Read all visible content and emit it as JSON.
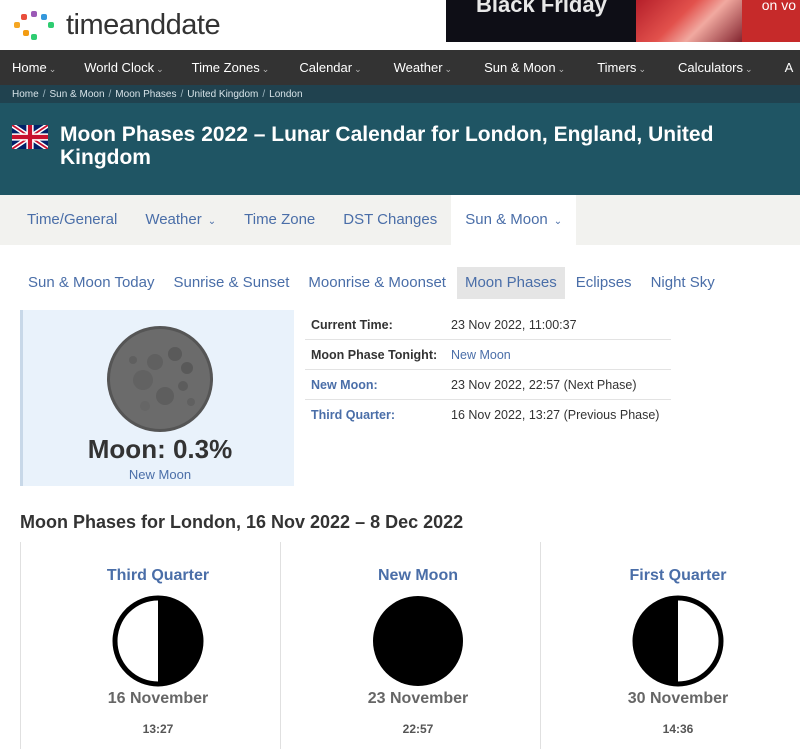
{
  "brand": {
    "name": "timeanddate"
  },
  "ad": {
    "headline": "Black Friday",
    "tagline": "on vo"
  },
  "nav": {
    "items": [
      {
        "label": "Home",
        "has_menu": true
      },
      {
        "label": "World Clock",
        "has_menu": true
      },
      {
        "label": "Time Zones",
        "has_menu": true
      },
      {
        "label": "Calendar",
        "has_menu": true
      },
      {
        "label": "Weather",
        "has_menu": true
      },
      {
        "label": "Sun & Moon",
        "has_menu": true
      },
      {
        "label": "Timers",
        "has_menu": true
      },
      {
        "label": "Calculators",
        "has_menu": true
      },
      {
        "label": "A",
        "has_menu": false
      }
    ]
  },
  "breadcrumb": [
    "Home",
    "Sun & Moon",
    "Moon Phases",
    "United Kingdom",
    "London"
  ],
  "page": {
    "title": "Moon Phases 2022 – Lunar Calendar for London, England, United Kingdom"
  },
  "subnav": {
    "items": [
      {
        "label": "Time/General",
        "active": false,
        "has_menu": false
      },
      {
        "label": "Weather",
        "active": false,
        "has_menu": true
      },
      {
        "label": "Time Zone",
        "active": false,
        "has_menu": false
      },
      {
        "label": "DST Changes",
        "active": false,
        "has_menu": false
      },
      {
        "label": "Sun & Moon",
        "active": true,
        "has_menu": true
      }
    ]
  },
  "tabs": {
    "items": [
      {
        "label": "Sun & Moon Today",
        "active": false
      },
      {
        "label": "Sunrise & Sunset",
        "active": false
      },
      {
        "label": "Moonrise & Moonset",
        "active": false
      },
      {
        "label": "Moon Phases",
        "active": true
      },
      {
        "label": "Eclipses",
        "active": false
      },
      {
        "label": "Night Sky",
        "active": false
      }
    ]
  },
  "moon_now": {
    "illumination": "Moon: 0.3%",
    "phase": "New Moon"
  },
  "info": {
    "rows": [
      {
        "label": "Current Time:",
        "value": "23 Nov 2022, 11:00:37",
        "label_link": false,
        "value_link": false
      },
      {
        "label": "Moon Phase Tonight:",
        "value": "New Moon",
        "label_link": false,
        "value_link": true
      },
      {
        "label": "New Moon:",
        "value": "23 Nov 2022, 22:57 (Next Phase)",
        "label_link": true,
        "value_link": false
      },
      {
        "label": "Third Quarter:",
        "value": "16 Nov 2022, 13:27 (Previous Phase)",
        "label_link": true,
        "value_link": false
      }
    ]
  },
  "phases_section": {
    "title": "Moon Phases for London, 16 Nov 2022 – 8 Dec 2022",
    "phases": [
      {
        "name": "Third Quarter",
        "date": "16 November",
        "time": "13:27",
        "kind": "third-quarter"
      },
      {
        "name": "New Moon",
        "date": "23 November",
        "time": "22:57",
        "kind": "new-moon"
      },
      {
        "name": "First Quarter",
        "date": "30 November",
        "time": "14:36",
        "kind": "first-quarter"
      }
    ]
  },
  "colors": {
    "link": "#4a6ea8",
    "nav_bg": "#333333",
    "title_bg": "#1f5564",
    "moon_box_bg": "#e9f2fb"
  }
}
